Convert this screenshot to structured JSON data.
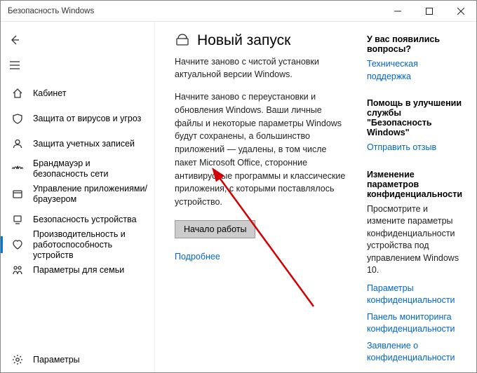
{
  "window": {
    "title": "Безопасность Windows"
  },
  "sidebar": {
    "items": [
      {
        "label": "Кабинет"
      },
      {
        "label": "Защита от вирусов и угроз"
      },
      {
        "label": "Защита учетных записей"
      },
      {
        "label": "Брандмауэр и безопасность сети"
      },
      {
        "label": "Управление приложениями/браузером"
      },
      {
        "label": "Безопасность устройства"
      },
      {
        "label": "Производительность и работоспособность устройств"
      },
      {
        "label": "Параметры для семьи"
      }
    ],
    "footer": {
      "label": "Параметры"
    }
  },
  "main": {
    "title": "Новый запуск",
    "intro": "Начните заново с чистой установки актуальной версии Windows.",
    "description": "Начните заново с переустановки и обновления Windows. Ваши личные файлы и некоторые параметры Windows будут сохранены, а большинство приложений — удалены, в том числе пакет Microsoft Office, сторонние антивирусные программы и классические приложения, с которыми поставлялось устройство.",
    "action_button": "Начало работы",
    "learn_more": "Подробнее"
  },
  "side": {
    "questions": {
      "heading": "У вас появились вопросы?",
      "link": "Техническая поддержка"
    },
    "feedback": {
      "heading": "Помощь в улучшении службы \"Безопасность Windows\"",
      "link": "Отправить отзыв"
    },
    "privacy": {
      "heading": "Изменение параметров конфиденциальности",
      "text": "Просмотрите и измените параметры конфиденциальности устройства под управлением Windows 10.",
      "links": [
        "Параметры конфиденциальности",
        "Панель мониторинга конфиденциальности",
        "Заявление о конфиденциальности"
      ]
    }
  }
}
